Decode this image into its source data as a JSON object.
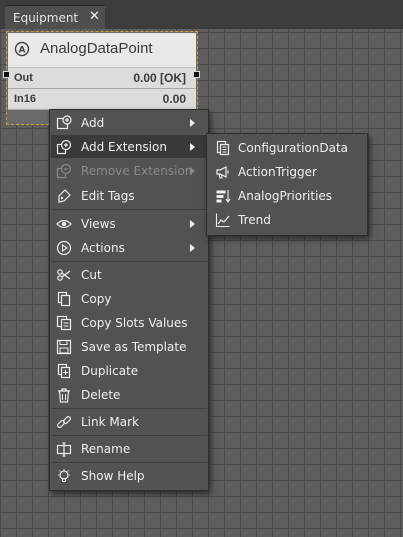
{
  "tab": {
    "label": "Equipment",
    "close": "✕"
  },
  "widget": {
    "title": "AnalogDataPoint",
    "slots": [
      {
        "name": "Out",
        "value": "0.00 [OK]"
      },
      {
        "name": "In16",
        "value": "0.00"
      }
    ]
  },
  "menu": {
    "items": [
      {
        "label": "Add",
        "icon": "add-icon",
        "submenu": true
      },
      {
        "label": "Add Extension",
        "icon": "add-extension-icon",
        "submenu": true,
        "highlighted": true
      },
      {
        "label": "Remove Extension",
        "icon": "remove-extension-icon",
        "submenu": true,
        "disabled": true
      },
      {
        "label": "Edit Tags",
        "icon": "edit-tags-icon"
      },
      {
        "label": "Views",
        "icon": "eye-icon",
        "submenu": true
      },
      {
        "label": "Actions",
        "icon": "play-icon",
        "submenu": true
      },
      {
        "label": "Cut",
        "icon": "scissors-icon"
      },
      {
        "label": "Copy",
        "icon": "copy-icon"
      },
      {
        "label": "Copy Slots Values",
        "icon": "copy-slots-icon"
      },
      {
        "label": "Save as Template",
        "icon": "save-template-icon"
      },
      {
        "label": "Duplicate",
        "icon": "duplicate-icon"
      },
      {
        "label": "Delete",
        "icon": "trash-icon"
      },
      {
        "label": "Link Mark",
        "icon": "link-icon"
      },
      {
        "label": "Rename",
        "icon": "rename-icon"
      },
      {
        "label": "Show Help",
        "icon": "lightbulb-icon"
      }
    ]
  },
  "submenu": {
    "items": [
      {
        "label": "ConfigurationData",
        "icon": "configuration-data-icon"
      },
      {
        "label": "ActionTrigger",
        "icon": "megaphone-icon"
      },
      {
        "label": "AnalogPriorities",
        "icon": "priorities-icon"
      },
      {
        "label": "Trend",
        "icon": "trend-chart-icon"
      }
    ]
  }
}
